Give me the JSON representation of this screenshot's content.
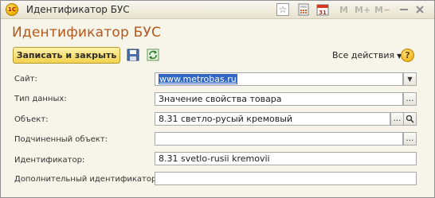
{
  "window": {
    "title": "Идентификатор БУС",
    "memory_buttons": [
      "M",
      "M+",
      "M−"
    ]
  },
  "form": {
    "title": "Идентификатор БУС",
    "save_close_label": "Записать и закрыть",
    "all_actions_label": "Все действия",
    "help_label": "?"
  },
  "fields": {
    "site": {
      "label": "Сайт:",
      "value": "www.metrobas.ru"
    },
    "data_type": {
      "label": "Тип данных:",
      "value": "Значение свойства товара"
    },
    "object": {
      "label": "Объект:",
      "value": "8.31 светло-русый кремовый"
    },
    "sub_object": {
      "label": "Подчиненный объект:",
      "value": ""
    },
    "identifier": {
      "label": "Идентификатор:",
      "value": "8.31 svetlo-rusii kremovii"
    },
    "extra_identifier": {
      "label": "Дополнительный идентификатор:",
      "value": ""
    }
  },
  "colors": {
    "title_orange": "#b4571a",
    "button_yellow": "#f2d24d",
    "selection_blue": "#3166c7"
  }
}
